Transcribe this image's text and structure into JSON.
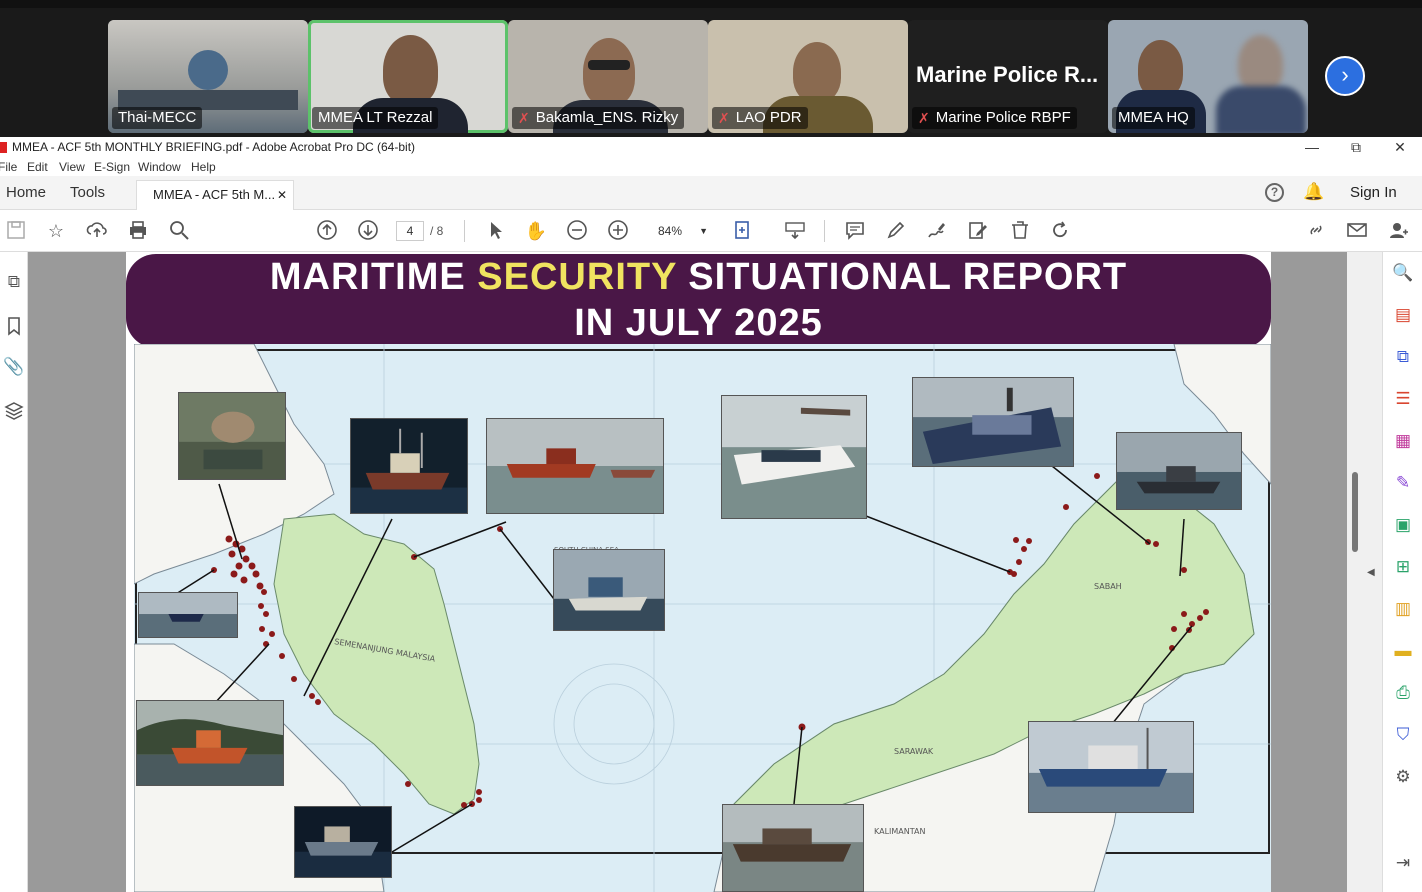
{
  "conference": {
    "participants": [
      {
        "name": "Thai-MECC",
        "muted": false
      },
      {
        "name": "MMEA LT Rezzal",
        "muted": false,
        "active": true
      },
      {
        "name": "Bakamla_ENS. Rizky",
        "muted": true
      },
      {
        "name": "LAO PDR",
        "muted": true
      },
      {
        "name": "Marine Police RBPF",
        "muted": true,
        "title_display": "Marine Police R..."
      },
      {
        "name": "MMEA HQ",
        "muted": false
      }
    ],
    "next_label": "›"
  },
  "window": {
    "title": "MMEA - ACF 5th MONTHLY BRIEFING.pdf - Adobe Acrobat Pro DC (64-bit)",
    "menu": [
      "File",
      "Edit",
      "View",
      "E-Sign",
      "Window",
      "Help"
    ],
    "nav": {
      "home": "Home",
      "tools": "Tools"
    },
    "tab_label": "MMEA - ACF 5th M...",
    "sign_in": "Sign In"
  },
  "toolbar": {
    "page_current": "4",
    "page_total": "/ 8",
    "zoom": "84%"
  },
  "slide": {
    "title_pre": "MARITIME ",
    "title_highlight": "SECURITY",
    "title_post": " SITUATIONAL REPORT",
    "subtitle": "IN JULY 2025",
    "colors": {
      "banner": "#4a1747",
      "highlight": "#f0e360",
      "sea": "#d8ecf4",
      "land": "#cde8b8",
      "incident": "#8b1a1a"
    }
  },
  "map": {
    "labels": [
      "SEMENANJUNG MALAYSIA",
      "SOUTH CHINA SEA",
      "SABAH",
      "SARAWAK",
      "KALIMANTAN"
    ]
  }
}
